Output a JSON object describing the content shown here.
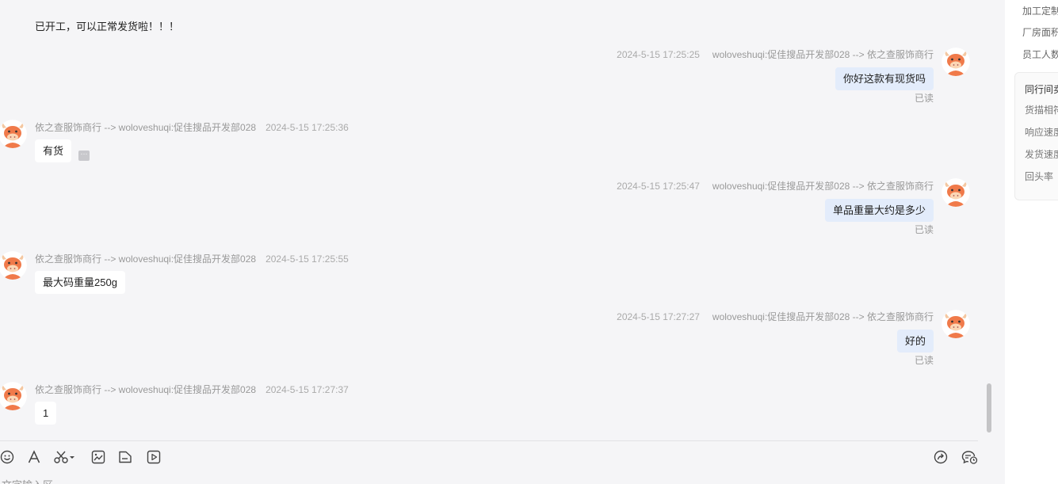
{
  "messages": {
    "first_text": "已开工，可以正常发货啦！！！",
    "m1": {
      "time": "2024-5-15 17:25:25",
      "route": "woloveshuqi:促佳搜品开发部028 --> 依之查服饰商行",
      "text": "你好这款有现货吗",
      "status": "已读"
    },
    "m2": {
      "route": "依之查服饰商行 --> woloveshuqi:促佳搜品开发部028",
      "time": "2024-5-15 17:25:36",
      "text": "有货",
      "more": "···"
    },
    "m3": {
      "time": "2024-5-15 17:25:47",
      "route": "woloveshuqi:促佳搜品开发部028 --> 依之查服饰商行",
      "text": "单品重量大约是多少",
      "status": "已读"
    },
    "m4": {
      "route": "依之查服饰商行 --> woloveshuqi:促佳搜品开发部028",
      "time": "2024-5-15 17:25:55",
      "text": "最大码重量250g"
    },
    "m5": {
      "time": "2024-5-15 17:27:27",
      "route": "woloveshuqi:促佳搜品开发部028 --> 依之查服饰商行",
      "text": "好的",
      "status": "已读"
    },
    "m6": {
      "route": "依之查服饰商行 --> woloveshuqi:促佳搜品开发部028",
      "time": "2024-5-15 17:27:37",
      "text": "1"
    }
  },
  "toolbar": {
    "icons": [
      "emoji-icon",
      "font-icon",
      "scissors-icon",
      "image-icon",
      "file-icon",
      "video-icon",
      "share-icon",
      "chat-history-icon"
    ]
  },
  "input": {
    "hint": "文字输入区"
  },
  "side": {
    "items": [
      "加工定制",
      "厂房面积",
      "员工人数"
    ],
    "card_title": "同行间卖",
    "card_items": [
      "货描相符",
      "响应速度",
      "发货速度",
      "回头率"
    ]
  },
  "colors": {
    "bubble_out": "#e3ecfb",
    "bubble_in": "#ffffff",
    "avatar_orange": "#f07a4a"
  }
}
